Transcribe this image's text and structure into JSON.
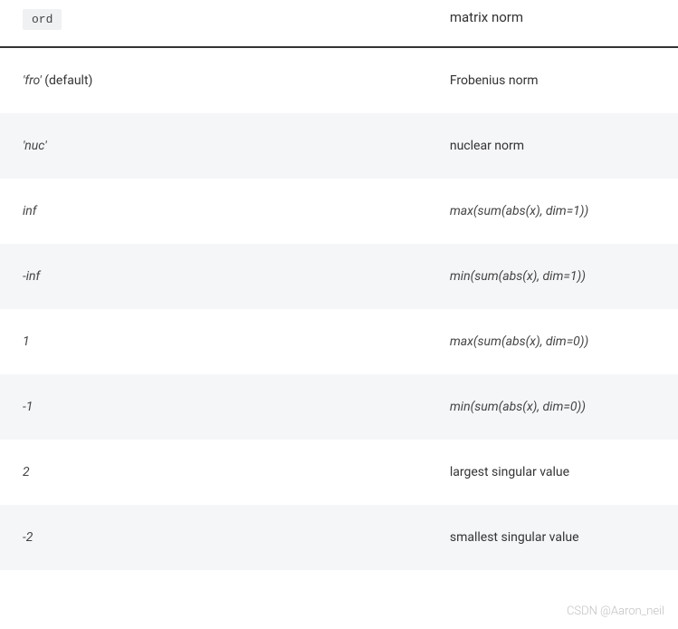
{
  "table": {
    "header": {
      "col1_code": "ord",
      "col2": "matrix norm"
    },
    "rows": [
      {
        "col1_italic": "'fro'",
        "col1_suffix": " (default)",
        "col2": "Frobenius norm",
        "col2_italic": false
      },
      {
        "col1_italic": "'nuc'",
        "col1_suffix": "",
        "col2": "nuclear norm",
        "col2_italic": false
      },
      {
        "col1_italic": "inf",
        "col1_suffix": "",
        "col2": "max(sum(abs(x), dim=1))",
        "col2_italic": true
      },
      {
        "col1_italic": "-inf",
        "col1_suffix": "",
        "col2": "min(sum(abs(x), dim=1))",
        "col2_italic": true
      },
      {
        "col1_italic": "1",
        "col1_suffix": "",
        "col2": "max(sum(abs(x), dim=0))",
        "col2_italic": true
      },
      {
        "col1_italic": "-1",
        "col1_suffix": "",
        "col2": "min(sum(abs(x), dim=0))",
        "col2_italic": true
      },
      {
        "col1_italic": "2",
        "col1_suffix": "",
        "col2": "largest singular value",
        "col2_italic": false
      },
      {
        "col1_italic": "-2",
        "col1_suffix": "",
        "col2": "smallest singular value",
        "col2_italic": false
      }
    ]
  },
  "watermark": "CSDN @Aaron_neil"
}
